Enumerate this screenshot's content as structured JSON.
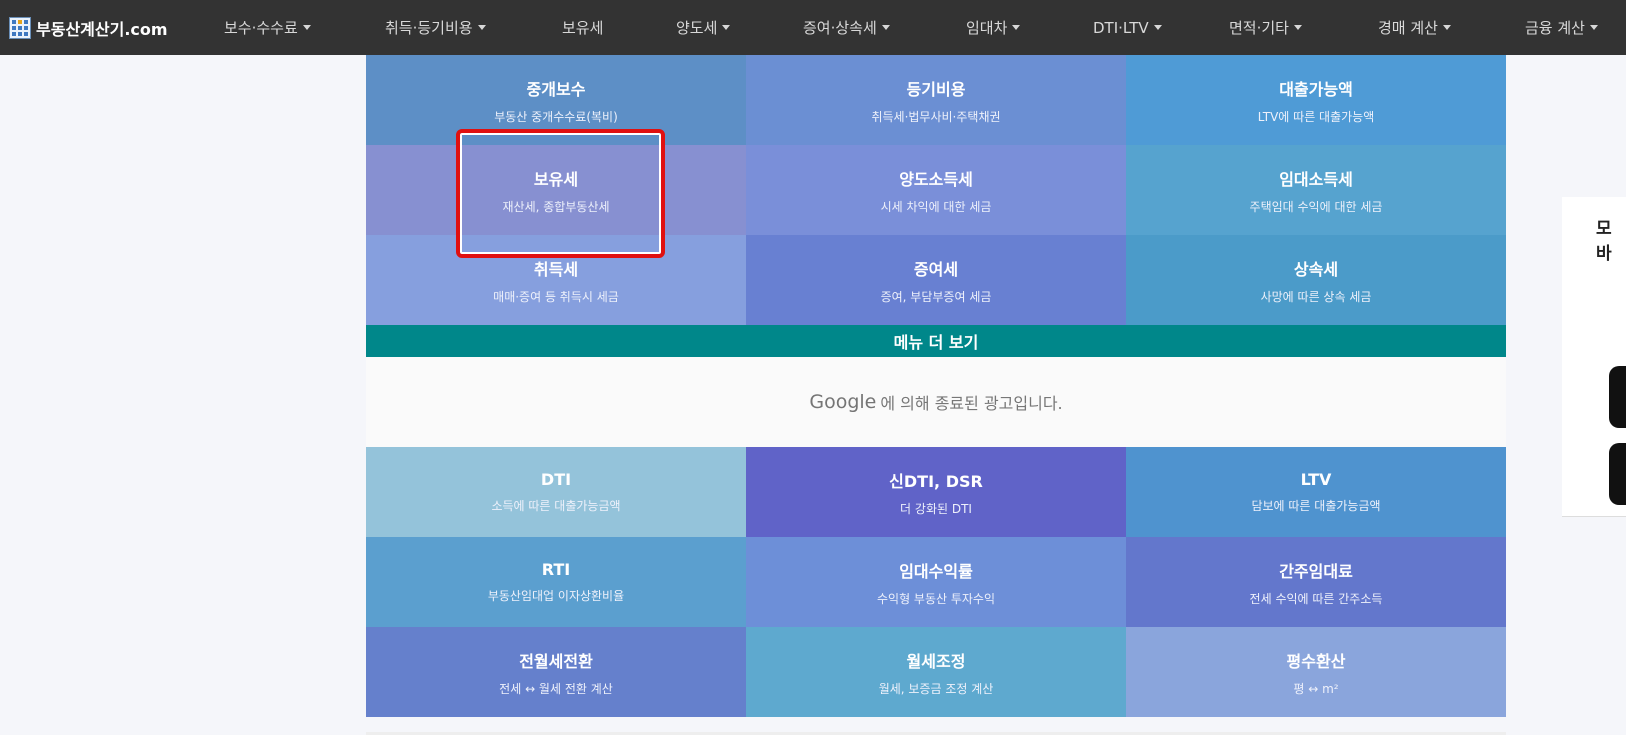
{
  "brand": {
    "title": "부동산계산기.com"
  },
  "nav": {
    "items": [
      {
        "label": "보수·수수료",
        "dropdown": true
      },
      {
        "label": "취득·등기비용",
        "dropdown": true
      },
      {
        "label": "보유세",
        "dropdown": false
      },
      {
        "label": "양도세",
        "dropdown": true
      },
      {
        "label": "증여·상속세",
        "dropdown": true
      },
      {
        "label": "임대차",
        "dropdown": true
      },
      {
        "label": "DTI·LTV",
        "dropdown": true
      },
      {
        "label": "면적·기타",
        "dropdown": true
      },
      {
        "label": "경매 계산",
        "dropdown": true
      },
      {
        "label": "금융 계산",
        "dropdown": true
      }
    ]
  },
  "top_tiles": [
    {
      "title": "중개보수",
      "sub": "부동산 중개수수료(복비)",
      "color": "#5d8fc6"
    },
    {
      "title": "등기비용",
      "sub": "취득세·법무사비·주택채권",
      "color": "#6b8fd3"
    },
    {
      "title": "대출가능액",
      "sub": "LTV에 따른 대출가능액",
      "color": "#4f9bd6"
    },
    {
      "title": "보유세",
      "sub": "재산세, 종합부동산세",
      "color": "#8790d1"
    },
    {
      "title": "양도소득세",
      "sub": "시세 차익에 대한 세금",
      "color": "#7a8fd9"
    },
    {
      "title": "임대소득세",
      "sub": "주택임대 수익에 대한 세금",
      "color": "#56a3cf"
    },
    {
      "title": "취득세",
      "sub": "매매·증여 등 취득시 세금",
      "color": "#869fde"
    },
    {
      "title": "증여세",
      "sub": "증여, 부담부증여 세금",
      "color": "#6880d2"
    },
    {
      "title": "상속세",
      "sub": "사망에 따른 상속 세금",
      "color": "#4b9bc9"
    }
  ],
  "more_menu": {
    "label": "메뉴 더 보기"
  },
  "ad": {
    "google": "Google",
    "text": "에 의해 종료된 광고입니다."
  },
  "bottom_tiles": [
    {
      "title": "DTI",
      "sub": "소득에 따른 대출가능금액",
      "color": "#94c3da"
    },
    {
      "title": "신DTI, DSR",
      "sub": "더 강화된 DTI",
      "color": "#6063c8"
    },
    {
      "title": "LTV",
      "sub": "담보에 따른 대출가능금액",
      "color": "#4f93cf"
    },
    {
      "title": "RTI",
      "sub": "부동산임대업 이자상환비율",
      "color": "#5b9fcf"
    },
    {
      "title": "임대수익률",
      "sub": "수익형 부동산 투자수익",
      "color": "#6d8fd8"
    },
    {
      "title": "간주임대료",
      "sub": "전세 수익에 따른 간주소득",
      "color": "#6377cc"
    },
    {
      "title": "전월세전환",
      "sub": "전세 ↔ 월세 전환 계산",
      "color": "#6580cc"
    },
    {
      "title": "월세조정",
      "sub": "월세, 보증금 조정 계산",
      "color": "#5ea9cf"
    },
    {
      "title": "평수환산",
      "sub": "평 ↔ m²",
      "color": "#8aa5dc"
    }
  ],
  "side": {
    "text": "모바"
  }
}
